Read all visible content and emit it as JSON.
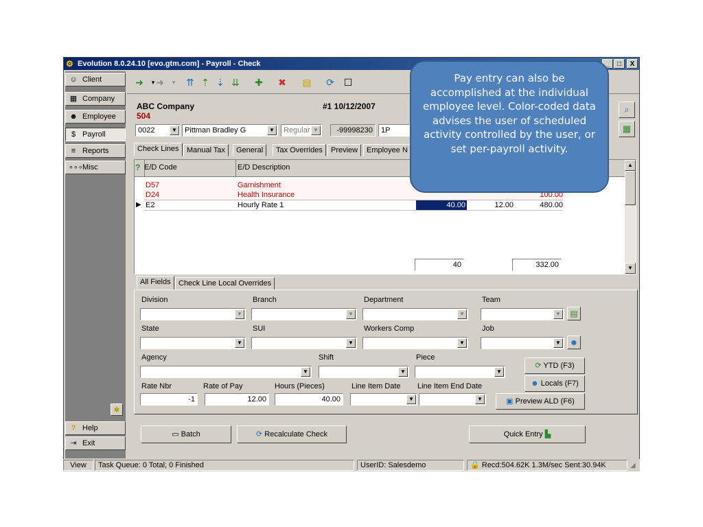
{
  "window": {
    "title": "Evolution 8.0.24.10 [evo.gtm.com] - Payroll - Check",
    "minimize": "_",
    "maximize": "□",
    "close": "X"
  },
  "sidebar": {
    "items": [
      {
        "label": "Client",
        "icon": "client-icon"
      },
      {
        "label": "Company",
        "icon": "company-icon"
      },
      {
        "label": "Employee",
        "icon": "employee-icon"
      },
      {
        "label": "Payroll",
        "icon": "payroll-icon"
      },
      {
        "label": "Reports",
        "icon": "reports-icon"
      },
      {
        "label": "Misc",
        "icon": "misc-icon"
      }
    ],
    "help": "Help",
    "exit": "Exit"
  },
  "header": {
    "company": "ABC Company",
    "company_code": "504",
    "check_info": "#1 10/12/2007",
    "employee_id": "0022",
    "employee_name": "Pittman Bradley G",
    "check_type": "Regular",
    "ssn": "-99998230",
    "check_field": "1P"
  },
  "tabs": [
    "Check Lines",
    "Manual Tax",
    "General",
    "Tax Overrides",
    "Preview",
    "Employee N"
  ],
  "grid": {
    "columns": [
      "E/D Code",
      "E/D Description"
    ],
    "rows": [
      {
        "code": "D57",
        "desc": "Garnishment",
        "hours": "",
        "rate": "",
        "amount": "",
        "color": "#cc0000"
      },
      {
        "code": "D24",
        "desc": "Health Insurance",
        "hours": "",
        "rate": "",
        "amount": "100.00",
        "color": "#cc0000"
      },
      {
        "code": "E2",
        "desc": "Hourly Rate 1",
        "hours": "40.00",
        "rate": "12.00",
        "amount": "480.00",
        "color": "#000000"
      }
    ],
    "total_hours": "40",
    "total_amount": "332.00"
  },
  "detail_tabs": [
    "All Fields",
    "Check Line Local Overrides"
  ],
  "fields": {
    "division": "Division",
    "branch": "Branch",
    "department": "Department",
    "team": "Team",
    "state": "State",
    "sui": "SUI",
    "workers_comp": "Workers Comp",
    "job": "Job",
    "agency": "Agency",
    "shift": "Shift",
    "piece": "Piece",
    "rate_nbr": "Rate Nbr",
    "rate_nbr_value": "-1",
    "rate_of_pay": "Rate of Pay",
    "rate_of_pay_value": "12.00",
    "hours": "Hours (Pieces)",
    "hours_value": "40.00",
    "line_item_date": "Line Item Date",
    "line_item_end_date": "Line Item End Date"
  },
  "side_buttons": {
    "ytd": "YTD (F3)",
    "locals": "Locals (F7)",
    "preview_ald": "Preview ALD (F6)"
  },
  "bottom_buttons": {
    "batch": "Batch",
    "recalculate": "Recalculate Check",
    "quick_entry": "Quick Entry"
  },
  "status": {
    "view": "View",
    "queue": "Task Queue: 0 Total; 0 Finished",
    "user": "UserID: Salesdemo",
    "stats": "Recd:504.62K  1.3M/sec  Sent:30.94K"
  },
  "callout": {
    "text": "Pay entry can also be accomplished at the individual employee level.  Color-coded data advises the user of scheduled activity controlled by the user, or set per-payroll activity."
  },
  "colors": {
    "title_start": "#0a246a",
    "title_end": "#3a6ea5",
    "deduction_text": "#cc0000",
    "selected_cell": "#0a246a",
    "callout_fill": "#4f81bd"
  }
}
